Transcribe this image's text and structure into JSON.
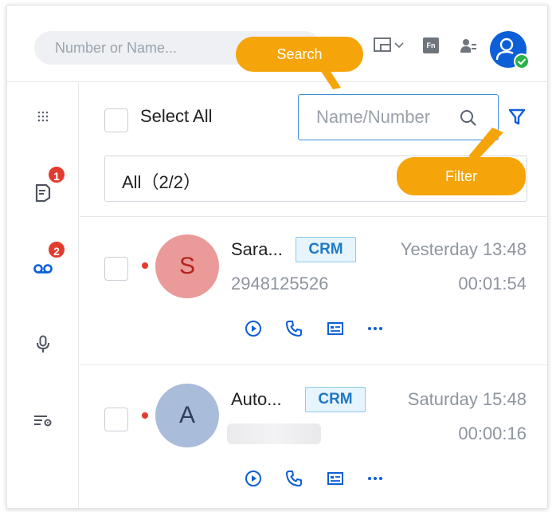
{
  "topbar": {
    "search_placeholder": "Number or Name...",
    "fn_label": "Fn"
  },
  "rail": {
    "badges": {
      "messages": "1",
      "voicemail": "2"
    }
  },
  "panel": {
    "select_all_label": "Select All",
    "search_placeholder": "Name/Number",
    "filter_value": "All（2/2）"
  },
  "voicemails": [
    {
      "initial": "S",
      "name": "Sara...",
      "tag": "CRM",
      "time": "Yesterday 13:48",
      "number": "2948125526",
      "duration": "00:01:54",
      "avatar_bg": "#eb9a9a",
      "avatar_fg": "#b5231c"
    },
    {
      "initial": "A",
      "name": "Auto...",
      "tag": "CRM",
      "time": "Saturday 15:48",
      "number": "",
      "duration": "00:00:16",
      "avatar_bg": "#a9bcd9",
      "avatar_fg": "#2d3f5c"
    }
  ],
  "callouts": {
    "search": "Search",
    "filter": "Filter"
  },
  "colors": {
    "accent": "#0d5fd8",
    "callout": "#f5a509",
    "badge": "#e23c2f",
    "crm_tag": "#1f78c4"
  },
  "icons": {
    "rail": [
      "dialpad-icon",
      "message-icon",
      "voicemail-icon",
      "recording-icon",
      "settings-list-icon"
    ],
    "actions": [
      "play-icon",
      "call-icon",
      "contact-card-icon",
      "more-icon"
    ]
  }
}
